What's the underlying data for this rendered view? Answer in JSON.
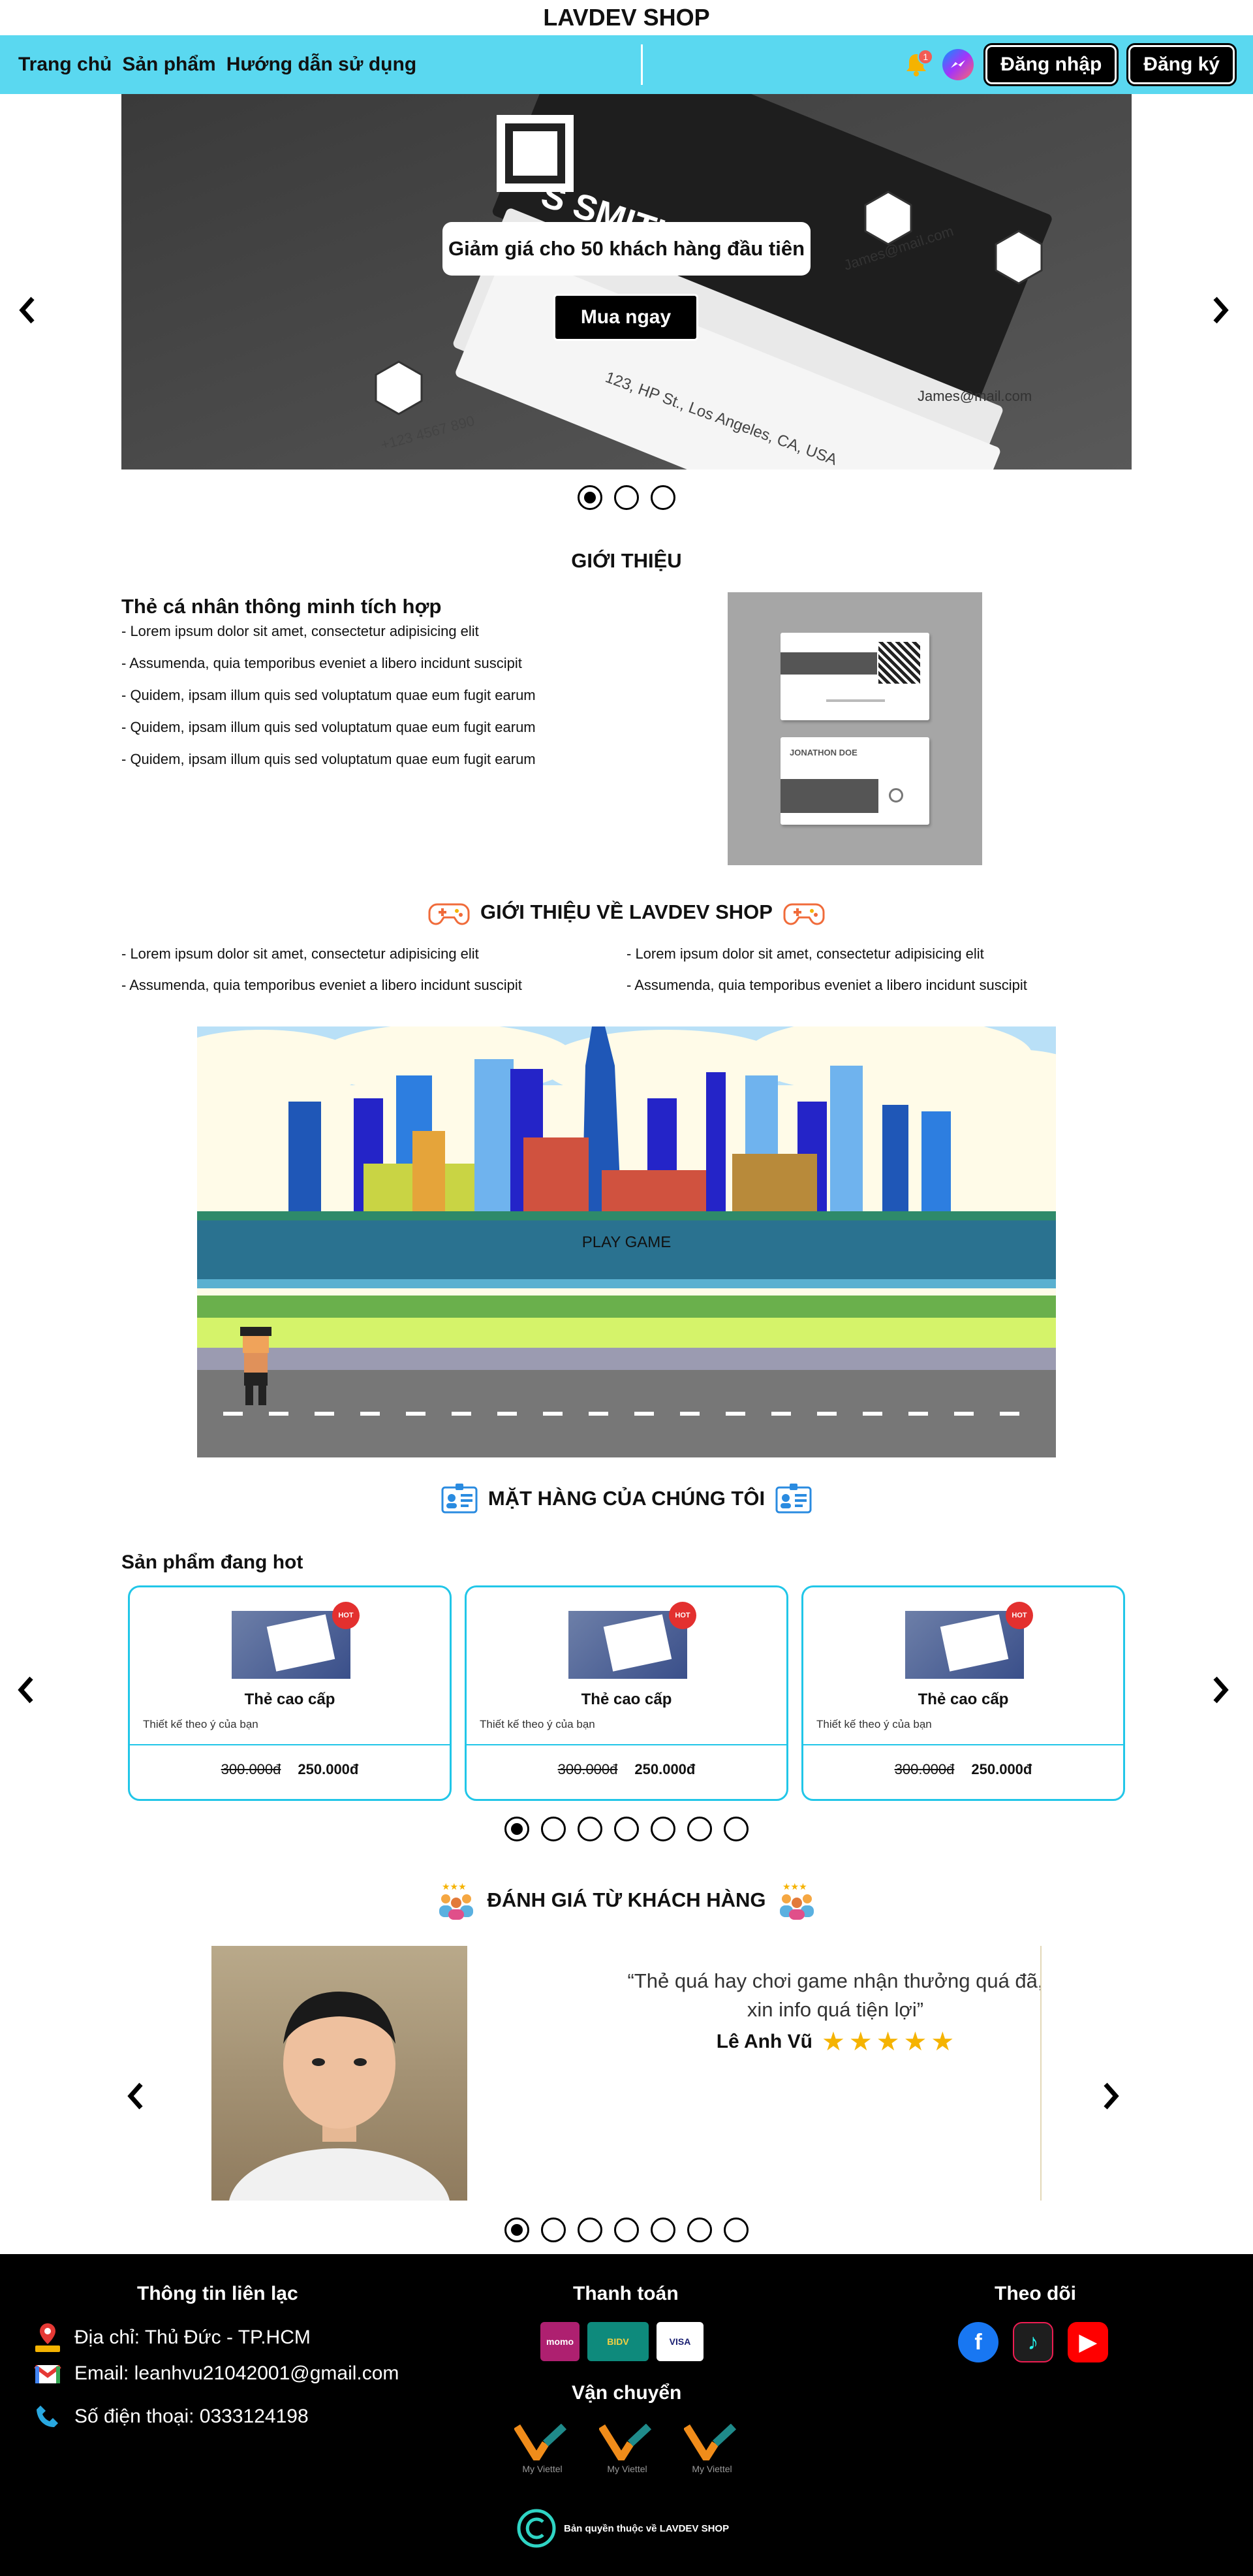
{
  "site_title": "LAVDEV SHOP",
  "nav": {
    "links": [
      "Trang chủ",
      "Sản phẩm",
      "Hướng dẫn sử dụng"
    ],
    "notification_count": "1",
    "login": "Đăng nhập",
    "register": "Đăng ký"
  },
  "hero": {
    "banner": "Giảm giá cho 50 khách hàng đầu tiên",
    "cta": "Mua ngay",
    "card_name": "S SMITH",
    "card_phone": "+123 4567 890",
    "card_address": "123, HP St., Los Angeles, CA, USA",
    "card_email_1": "James@mail.com",
    "card_email_2": "James@mail.com",
    "prev": "‹",
    "next": "›"
  },
  "intro": {
    "heading": "GIỚI THIỆU",
    "title": "Thẻ cá nhân thông minh tích hợp",
    "lines": [
      "- Lorem ipsum dolor sit amet, consectetur adipisicing elit",
      "- Assumenda, quia temporibus eveniet a libero incidunt suscipit",
      "- Quidem, ipsam illum quis sed voluptatum quae eum fugit earum",
      "- Quidem, ipsam illum quis sed voluptatum quae eum fugit earum",
      "- Quidem, ipsam illum quis sed voluptatum quae eum fugit earum"
    ],
    "card_name": "JONATHON DOE"
  },
  "about": {
    "heading": "GIỚI THIỆU VỀ LAVDEV SHOP",
    "left": [
      "- Lorem ipsum dolor sit amet, consectetur adipisicing elit",
      "- Assumenda, quia temporibus eveniet a libero incidunt suscipit"
    ],
    "right": [
      "- Lorem ipsum dolor sit amet, consectetur adipisicing elit",
      "- Assumenda, quia temporibus eveniet a libero incidunt suscipit"
    ]
  },
  "game": {
    "play_label": "PLAY GAME"
  },
  "products": {
    "heading": "MẶT HÀNG CỦA CHÚNG TÔI",
    "subheading": "Sản phẩm đang hot",
    "hot_badge": "HOT",
    "items": [
      {
        "name": "Thẻ cao cấp",
        "desc": "Thiết kế theo ý của bạn",
        "old_price": "300.000đ",
        "price": "250.000đ"
      },
      {
        "name": "Thẻ cao cấp",
        "desc": "Thiết kế theo ý của bạn",
        "old_price": "300.000đ",
        "price": "250.000đ"
      },
      {
        "name": "Thẻ cao cấp",
        "desc": "Thiết kế theo ý của bạn",
        "old_price": "300.000đ",
        "price": "250.000đ"
      }
    ],
    "page_count": 7,
    "active_page": 1
  },
  "review": {
    "heading": "ĐÁNH GIÁ TỪ KHÁCH HÀNG",
    "quote_line1": "“Thẻ quá hay chơi game nhận thưởng quá đã,",
    "quote_line2": "xin info quá tiện lợi”",
    "author": "Lê Anh Vũ",
    "rating": 5,
    "page_count": 7,
    "active_page": 1
  },
  "footer": {
    "contact_heading": "Thông tin liên lạc",
    "address": "Địa chỉ: Thủ Đức - TP.HCM",
    "email": "Email: leanhvu21042001@gmail.com",
    "phone": "Số điện thoại: 0333124198",
    "payment_heading": "Thanh toán",
    "payments": [
      "momo",
      "BIDV",
      "VISA"
    ],
    "shipping_heading": "Vận chuyển",
    "shipping_label": "My Viettel",
    "follow_heading": "Theo dõi",
    "copyright": "Bản quyền thuộc về LAVDEV SHOP"
  },
  "colors": {
    "accent": "#5ad8f0",
    "card_border": "#21c6e8",
    "star": "#f5b301"
  }
}
